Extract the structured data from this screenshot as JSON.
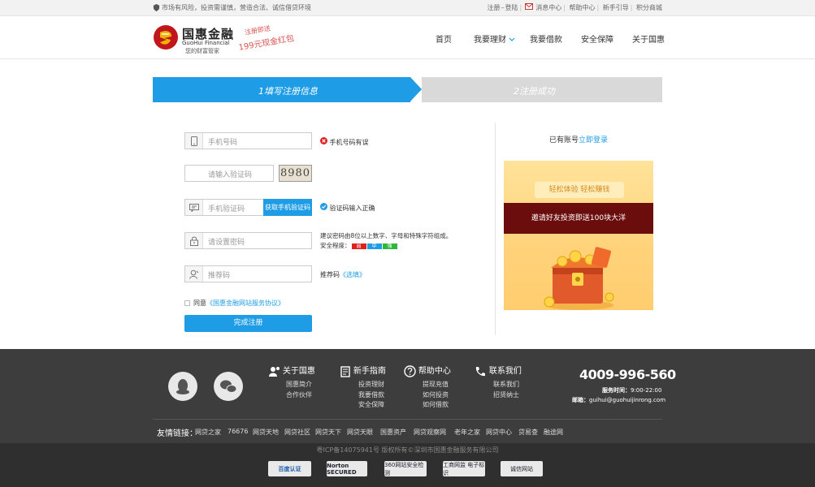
{
  "topbar": {
    "notice": "市场有风险，投资需谨慎，营造合法、诚信借贷环境",
    "links": [
      "注册",
      "登陆",
      "消息中心",
      "帮助中心",
      "新手引导",
      "积分商城"
    ]
  },
  "header": {
    "logo_cn": "国惠金融",
    "logo_en": "GuoHui Financial",
    "logo_slogan": "您的财富管家",
    "promo_line1": "注册即送",
    "promo_line2": "199元现金红包",
    "nav": [
      "首页",
      "我要理财",
      "我要借款",
      "安全保障",
      "关于国惠"
    ]
  },
  "steps": {
    "step1": "1填写注册信息",
    "step2": "2注册成功"
  },
  "form": {
    "phone_placeholder": "手机号码",
    "phone_error": "手机号码有误",
    "captcha_placeholder": "请输入验证码",
    "captcha_text": "8980",
    "sms_placeholder": "手机验证码",
    "sms_button": "获取手机验证码",
    "sms_ok": "验证码输入正确",
    "password_placeholder": "请设置密码",
    "password_hint": "建议密码由8位以上数字、字母和特殊字符组成。",
    "strength_label": "安全程度：",
    "strength_levels": [
      "弱",
      "中",
      "强"
    ],
    "referrer_placeholder": "推荐码",
    "referrer_hint_label": "推荐码",
    "referrer_hint_optional": "《选填》",
    "agree_label": "同意",
    "agree_link": "《国惠金融网站服务协议》",
    "submit": "完成注册"
  },
  "sidebar": {
    "have_account": "已有账号",
    "login_link": "立即登录",
    "ad_tagline": "轻松体验  轻松赚钱",
    "ad_banner": "邀请好友投资即送100块大洋"
  },
  "footer": {
    "sections": [
      {
        "title": "关于国惠",
        "items": [
          "国惠简介",
          "合作伙伴"
        ]
      },
      {
        "title": "新手指南",
        "items": [
          "投资理财",
          "我要借款",
          "安全保障"
        ]
      },
      {
        "title": "帮助中心",
        "items": [
          "提现充值",
          "如何投资",
          "如何借款"
        ]
      },
      {
        "title": "联系我们",
        "items": [
          "联系我们",
          "招贤纳士"
        ]
      }
    ],
    "phone": "4009-996-560",
    "service_hours_label": "服务时间：",
    "service_hours": "9:00-22:00",
    "email_label": "邮箱：",
    "email": "guihui@guohuijinrong.com",
    "friend_label": "友情链接：",
    "friend_links": [
      "网贷之家",
      "76676",
      "网贷天地",
      "网贷社区",
      "网贷天下",
      "网贷天眼",
      "国惠资产",
      "网贷观察网",
      "老年之家",
      "网贷中心",
      "贷易查",
      "融途网"
    ],
    "copyright": "粤ICP备14075941号 版权所有©深圳市国惠金融服务有限公司",
    "badges": [
      "百度认证",
      "Norton SECURED",
      "360网站安全检测",
      "工商网监 电子标识",
      "诚信网站"
    ]
  },
  "colors": {
    "accent": "#1e9ce6",
    "error": "#e02020",
    "footer_bg": "#3d3d3d"
  }
}
